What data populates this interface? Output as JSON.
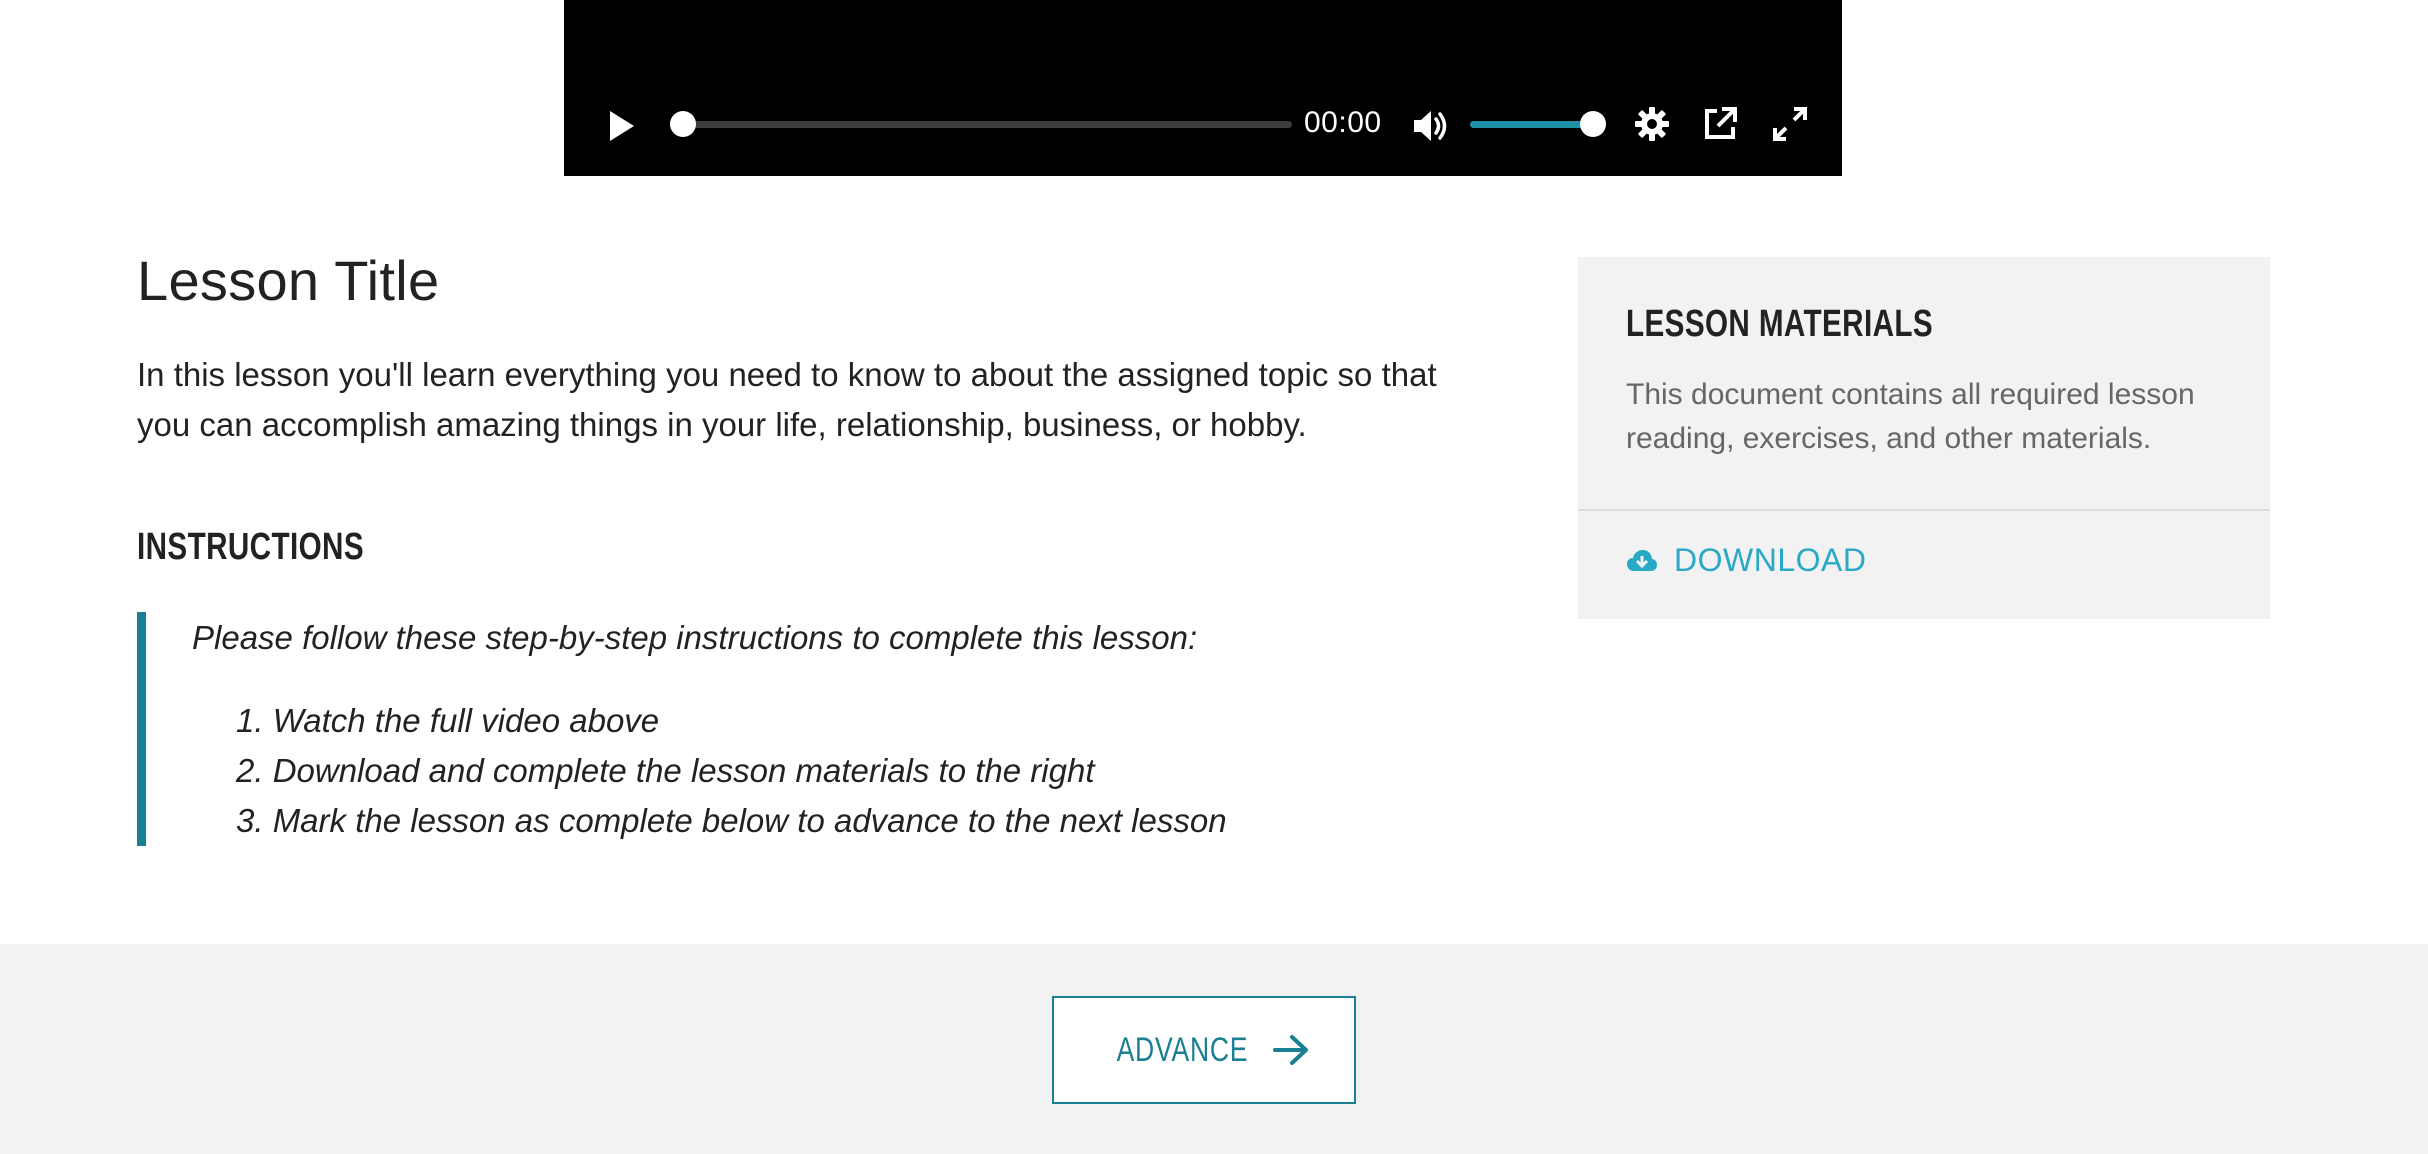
{
  "player": {
    "time": "00:00",
    "seek_progress": 0.0,
    "volume_level": 1.0,
    "icons": {
      "play": "play-icon",
      "volume": "volume-icon",
      "settings": "gear-icon",
      "popout": "popout-icon",
      "fullscreen": "fullscreen-icon"
    },
    "accent_color": "#1d90a8"
  },
  "lesson": {
    "title": "Lesson Title",
    "description": "In this lesson you'll learn everything you need to know to about the assigned topic so that you can accomplish amazing things in your life, relationship, business, or hobby."
  },
  "instructions": {
    "heading": "INSTRUCTIONS",
    "intro": "Please follow these step-by-step instructions to complete this lesson:",
    "steps": [
      "1. Watch the full video above",
      "2. Download and complete the lesson materials to the right",
      "3. Mark the lesson as complete below to advance to the next lesson"
    ],
    "accent_color": "#1b7f93"
  },
  "materials": {
    "heading": "LESSON MATERIALS",
    "description": "This document contains all required lesson reading, exercises, and other materials.",
    "download_label": "DOWNLOAD",
    "download_icon": "cloud-download-icon",
    "link_color": "#29a9c6"
  },
  "footer": {
    "advance_label": "ADVANCE",
    "advance_icon": "arrow-right-icon",
    "button_color": "#1b7f93"
  }
}
